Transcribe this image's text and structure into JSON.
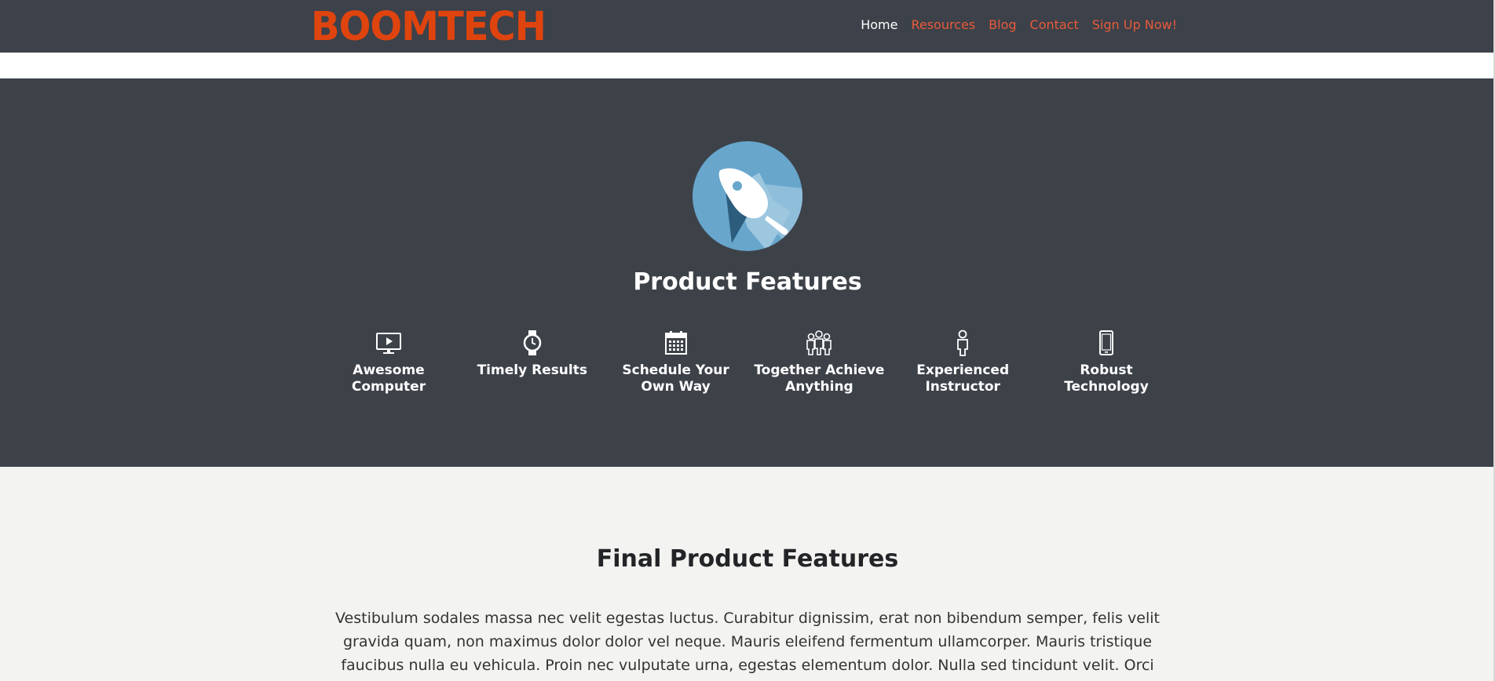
{
  "header": {
    "logo": "BOOMTECH",
    "nav": [
      {
        "label": "Home",
        "active": true
      },
      {
        "label": "Resources",
        "active": false
      },
      {
        "label": "Blog",
        "active": false
      },
      {
        "label": "Contact",
        "active": false
      },
      {
        "label": "Sign Up Now!",
        "active": false
      }
    ]
  },
  "features": {
    "hero_icon": "rocket-icon",
    "title": "Product Features",
    "items": [
      {
        "label": "Awesome Computer",
        "icon": "monitor-icon"
      },
      {
        "label": "Timely Results",
        "icon": "watch-icon"
      },
      {
        "label": "Schedule Your Own Way",
        "icon": "calendar-icon"
      },
      {
        "label": "Together Achieve Anything",
        "icon": "group-icon"
      },
      {
        "label": "Experienced Instructor",
        "icon": "person-icon"
      },
      {
        "label": "Robust Technology",
        "icon": "phone-icon"
      }
    ]
  },
  "final": {
    "title": "Final Product Features",
    "body": "Vestibulum sodales massa nec velit egestas luctus. Curabitur dignissim, erat non bibendum semper, felis velit gravida quam, non maximus dolor dolor vel neque. Mauris eleifend fermentum ullamcorper. Mauris tristique faucibus nulla eu vehicula. Proin nec vulputate urna, egestas elementum dolor. Nulla sed tincidunt velit. Orci varius natoque penatibus et"
  },
  "colors": {
    "brand": "#e0440e",
    "nav_link": "#e85a3a",
    "dark_bg": "#3d4249",
    "hero_circle": "#6aa7cd"
  }
}
